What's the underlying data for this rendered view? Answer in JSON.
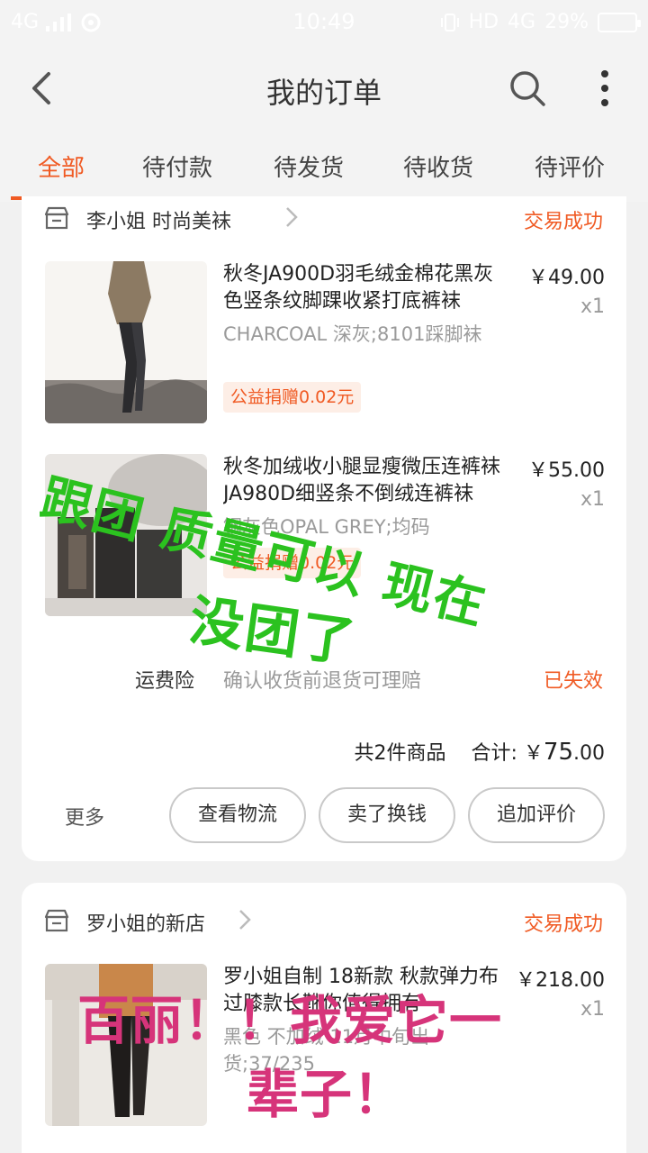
{
  "status_bar": {
    "signal": "4G",
    "time": "10:49",
    "hd": "HD",
    "network": "4G",
    "battery": "29%"
  },
  "header": {
    "title": "我的订单"
  },
  "tabs": [
    {
      "label": "全部",
      "active": true
    },
    {
      "label": "待付款",
      "active": false
    },
    {
      "label": "待发货",
      "active": false
    },
    {
      "label": "待收货",
      "active": false
    },
    {
      "label": "待评价",
      "active": false
    }
  ],
  "orders": [
    {
      "shop_name": "李小姐 时尚美袜",
      "status": "交易成功",
      "items": [
        {
          "title": "秋冬JA900D羽毛绒金棉花黑灰色竖条纹脚踝收紧打底裤袜",
          "spec": "CHARCOAL 深灰;8101踩脚袜",
          "badge": "公益捐赠0.02元",
          "price": "￥49.00",
          "qty": "x1"
        },
        {
          "title": "秋冬加绒收小腿显瘦微压连裤袜 JA980D细竖条不倒绒连裤袜",
          "spec": "钢灰色OPAL GREY;均码",
          "badge": "公益捐赠0.02元",
          "price": "￥55.00",
          "qty": "x1"
        }
      ],
      "insurance": {
        "label": "运费险",
        "desc": "确认收货前退货可理赔",
        "status": "已失效"
      },
      "summary": {
        "count": "共2件商品",
        "total_label": "合计:",
        "currency": "￥",
        "amount_int": "75",
        "amount_dec": ".00"
      },
      "actions": {
        "more": "更多",
        "logistics": "查看物流",
        "resell": "卖了换钱",
        "review": "追加评价"
      }
    },
    {
      "shop_name": "罗小姐的新店",
      "status": "交易成功",
      "items": [
        {
          "title": "罗小姐自制 18新款 秋款弹力布过膝款长靴你值得拥有",
          "spec": "黑色 不加绒 11月中旬出货;37/235",
          "price": "￥218.00",
          "qty": "x1"
        }
      ]
    }
  ],
  "annotations": {
    "green_line1": "跟团 质量可以 现在",
    "green_line2": "没团了",
    "pink_line1": "百丽！！我爱它一",
    "pink_line2": "辈子！",
    "green_color": "#2bc21f",
    "pink_color": "#d6347a"
  },
  "colors": {
    "accent": "#f05a23",
    "background": "#f1f1f1"
  }
}
